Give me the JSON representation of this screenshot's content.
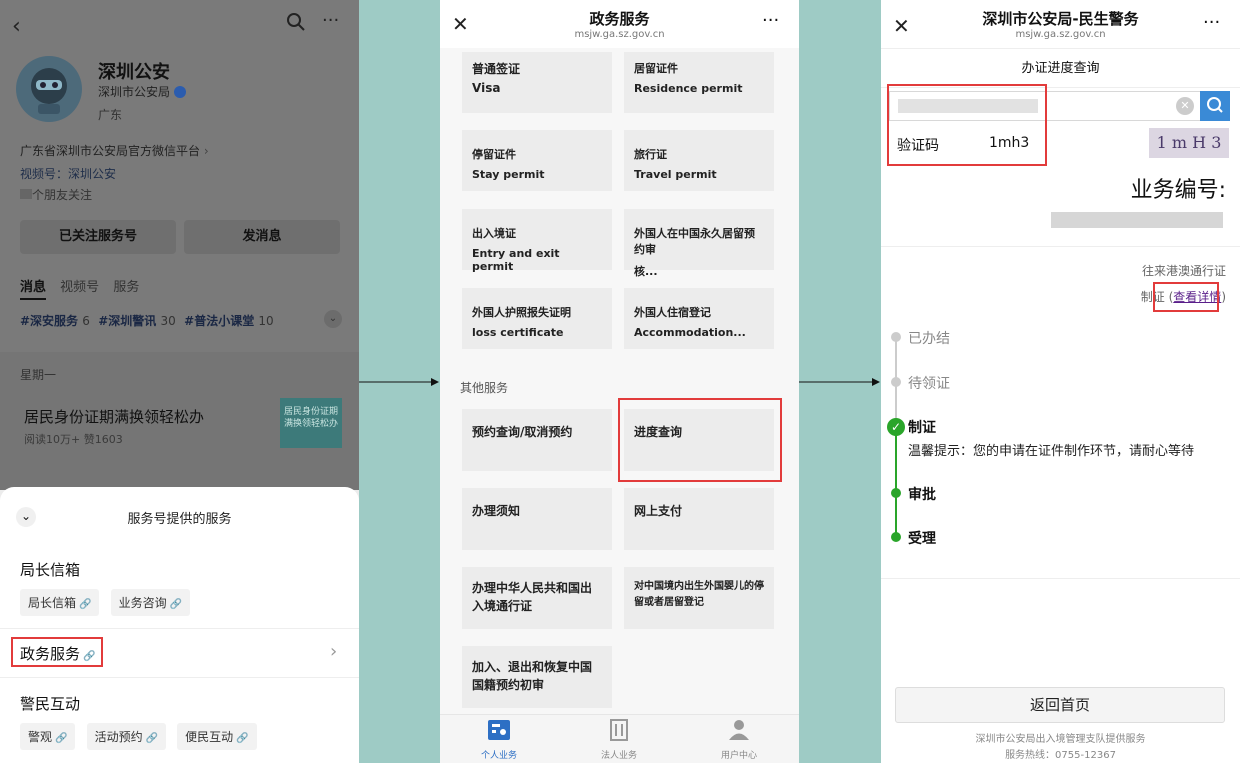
{
  "panel1": {
    "account_name": "深圳公安",
    "verified_by": "深圳市公安局",
    "region": "广东",
    "description": "广东省深圳市公安局官方微信平台",
    "channel": "视频号：深圳公安",
    "friends": "个朋友关注",
    "followed_button": "已关注服务号",
    "message_button": "发消息",
    "tabs": [
      "消息",
      "视频号",
      "服务"
    ],
    "tags": [
      {
        "label": "#深安服务",
        "count": "6"
      },
      {
        "label": "#深圳警讯",
        "count": "30"
      },
      {
        "label": "#普法小课堂",
        "count": "10"
      }
    ],
    "weekday": "星期一",
    "article_title": "居民身份证期满换领轻松办",
    "article_meta": "阅读10万+  赞1603",
    "thumb_text": "居民身份证期满换领轻松办",
    "sheet_title": "服务号提供的服务",
    "sections": [
      {
        "title": "局长信箱",
        "chips": [
          "局长信箱",
          "业务咨询"
        ]
      },
      {
        "title": "政务服务",
        "chips": []
      },
      {
        "title": "警民互动",
        "chips": [
          "警观",
          "活动预约",
          "便民互动"
        ]
      }
    ]
  },
  "panel2": {
    "title": "政务服务",
    "url": "msjw.ga.sz.gov.cn",
    "permits": [
      {
        "zh": "普通签证",
        "en": "Visa"
      },
      {
        "zh": "居留证件",
        "en": "Residence permit"
      },
      {
        "zh": "停留证件",
        "en": "Stay permit"
      },
      {
        "zh": "旅行证",
        "en": "Travel permit"
      },
      {
        "zh": "出入境证",
        "en": "Entry and exit permit"
      },
      {
        "zh": "外国人在中国永久居留预约审",
        "en": "核..."
      },
      {
        "zh": "外国人护照报失证明",
        "en": "loss certificate"
      },
      {
        "zh": "外国人住宿登记",
        "en": "Accommodation..."
      }
    ],
    "other_heading": "其他服务",
    "services": [
      "预约查询/取消预约",
      "进度查询",
      "办理须知",
      "网上支付",
      "办理中华人民共和国出入境通行证",
      "对中国境内出生外国婴儿的停留或者居留登记",
      "加入、退出和恢复中国国籍预约初审"
    ],
    "tabs": [
      "个人业务",
      "法人业务",
      "用户中心"
    ]
  },
  "panel3": {
    "title": "深圳市公安局-民生警务",
    "url": "msjw.ga.sz.gov.cn",
    "subtitle": "办证进度查询",
    "captcha_label": "验证码",
    "captcha_value": "1mh3",
    "captcha_image_text": "1 m H 3",
    "business_no_label": "业务编号:",
    "doc_type": "往来港澳通行证",
    "status_text": "制证",
    "detail_link": "查看详情",
    "timeline": [
      {
        "label": "已办结",
        "state": "pending"
      },
      {
        "label": "待领证",
        "state": "pending"
      },
      {
        "label": "制证",
        "state": "current"
      },
      {
        "label": "审批",
        "state": "done"
      },
      {
        "label": "受理",
        "state": "done"
      }
    ],
    "tip": "温馨提示：您的申请在证件制作环节，请耐心等待",
    "home_button": "返回首页",
    "footer_line1": "深圳市公安局出入境管理支队提供服务",
    "footer_line2": "服务热线：0755-12367"
  },
  "colors": {
    "highlight": "#e23b3b",
    "progress_green": "#2aa52a",
    "link": "#5a1f8a",
    "search_blue": "#3a8ad6"
  }
}
